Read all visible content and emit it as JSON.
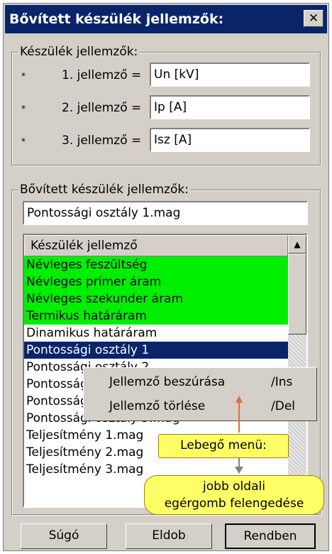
{
  "title": "Bővített készülék jellemzők:",
  "close_label": "✕",
  "props_group": {
    "legend": "Készülék jellemzők:",
    "rows": [
      {
        "star": "*",
        "label": "1. jellemző =",
        "value": "Un [kV]"
      },
      {
        "star": "*",
        "label": "2. jellemző =",
        "value": "Ip [A]"
      },
      {
        "star": "*",
        "label": "3. jellemző =",
        "value": "Isz [A]"
      }
    ]
  },
  "ext_group": {
    "legend": "Bővített készülék jellemzők:",
    "input_value": "Pontossági osztály 1.mag",
    "list_header": "Készülék jellemző",
    "items": [
      "Névleges feszültség",
      "Névleges primer áram",
      "Névleges szekunder áram",
      "Termikus határáram",
      "Dinamikus határáram",
      "Pontossági osztály 1",
      "Pontossági osztály 2",
      "Pontossági osztály 3",
      "Pontossági osztály 4.mag",
      "Pontossági osztály 5.mag",
      "Teljesítmény 1.mag",
      "Teljesítmény 2.mag",
      "Teljesítmény 3.mag"
    ],
    "highlighted_count": 4,
    "selected_index": 5
  },
  "context_menu": {
    "items": [
      {
        "label": "Jellemző beszúrása",
        "shortcut": "/Ins"
      },
      {
        "label": "Jellemző törlése",
        "shortcut": "/Del"
      }
    ]
  },
  "callouts": {
    "menu": "Lebegő menü:",
    "hint_line1": "jobb oldali",
    "hint_line2": "egérgomb felengedése"
  },
  "buttons": {
    "help": "Súgó",
    "discard": "Eldob",
    "ok": "Rendben"
  },
  "colors": {
    "title_bg": "#0a246a",
    "highlight": "#00ee00",
    "selection": "#0a246a",
    "callout": "#ffff66",
    "arrow": "#e07030"
  }
}
